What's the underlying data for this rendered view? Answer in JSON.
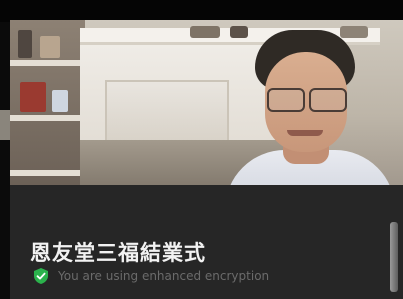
{
  "meeting": {
    "title": "恩友堂三福結業式"
  },
  "security": {
    "encryption_message": "You are using enhanced encryption",
    "icon": "shield-check-icon",
    "icon_color": "#2bb24c"
  },
  "colors": {
    "overlay_background": "#262626",
    "title_text": "#f2f2f2",
    "encryption_text": "#6b6b6b"
  }
}
